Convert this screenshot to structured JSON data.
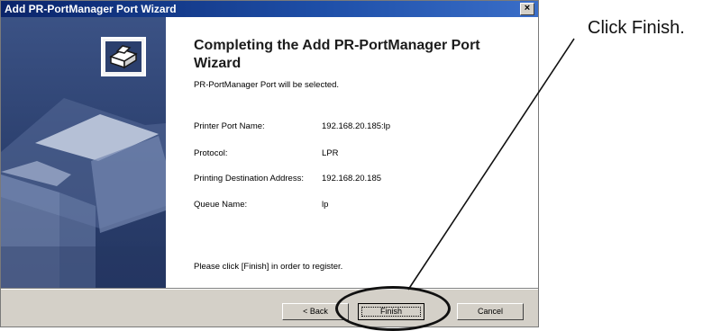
{
  "window": {
    "title": "Add PR-PortManager Port Wizard",
    "close_glyph": "×"
  },
  "wizard": {
    "heading_line1": "Completing the Add PR-PortManager Port",
    "heading_line2": "Wizard",
    "subtitle": "PR-PortManager Port will be selected.",
    "fields": [
      {
        "label": "Printer Port Name:",
        "value": "192.168.20.185:lp"
      },
      {
        "label": "Protocol:",
        "value": "LPR"
      },
      {
        "label": "Printing Destination Address:",
        "value": "192.168.20.185"
      },
      {
        "label": "Queue Name:",
        "value": "lp"
      }
    ],
    "footer": "Please click [Finish] in order to register."
  },
  "buttons": {
    "back_label": "< Back",
    "finish_label": "Finish",
    "cancel_label": "Cancel"
  },
  "annotation": {
    "callout_text": "Click Finish."
  },
  "icons": {
    "wizard_icon": "printer-icon",
    "side_panel_art": "printer-illustration"
  }
}
